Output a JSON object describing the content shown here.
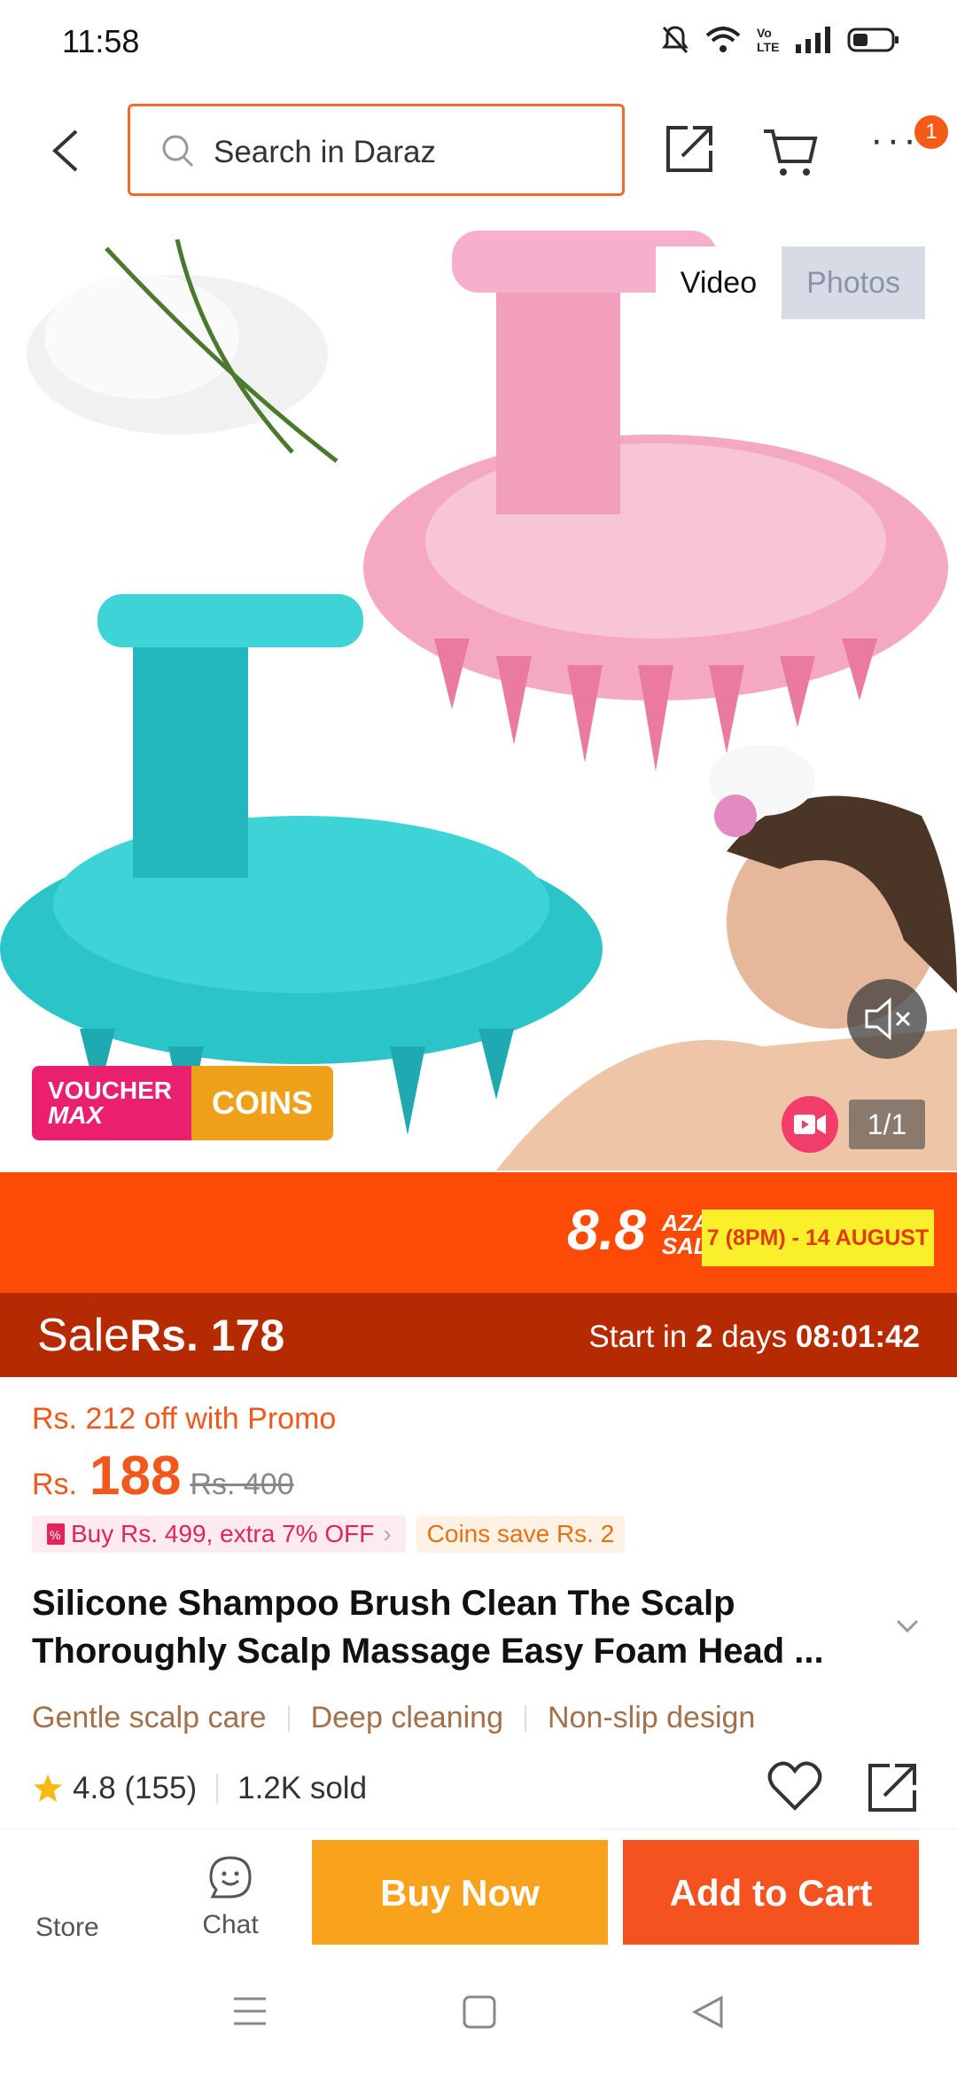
{
  "status_bar": {
    "time": "11:58"
  },
  "header": {
    "search_placeholder": "Search in Daraz",
    "cart_badge": "1"
  },
  "media": {
    "tabs": [
      "Video",
      "Photos"
    ],
    "active_tab": "Video",
    "counter": "1/1",
    "voucher_top": "VOUCHER",
    "voucher_sub": "MAX",
    "coins_label": "COINS"
  },
  "campaign": {
    "logo_number": "8.8",
    "logo_line1": "AZADI",
    "logo_line2": "SALE",
    "dates": "7 (8PM) - 14 AUGUST"
  },
  "sale": {
    "label": "Sale",
    "price": "Rs. 178",
    "countdown_prefix": "Start in",
    "days": "2",
    "days_label": "days",
    "time": "08:01:42"
  },
  "pricing": {
    "promo_text": "Rs. 212 off with Promo",
    "currency": "Rs.",
    "current": "188",
    "original": "Rs. 400"
  },
  "chips": {
    "bundle": "Buy Rs. 499, extra 7% OFF",
    "coins": "Coins save Rs. 2"
  },
  "product": {
    "title": "Silicone Shampoo Brush Clean The Scalp Thoroughly Scalp Massage Easy Foam Head ...",
    "tags": [
      "Gentle scalp care",
      "Deep cleaning",
      "Non-slip design"
    ],
    "rating": "4.8",
    "reviews": "(155)",
    "sold": "1.2K sold"
  },
  "actions": {
    "store": "Store",
    "chat": "Chat",
    "buy_now": "Buy Now",
    "add_to_cart": "Add to Cart"
  },
  "colors": {
    "accent": "#f4521f",
    "sale_bar": "#b52a00",
    "buy_now": "#f9a21b"
  }
}
